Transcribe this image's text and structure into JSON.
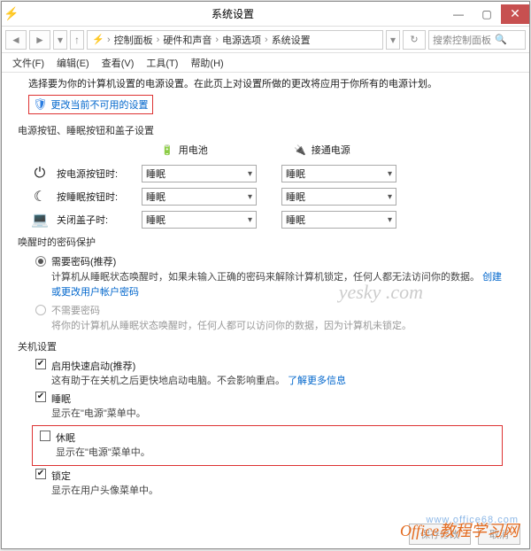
{
  "titlebar": {
    "title": "系统设置"
  },
  "breadcrumb": {
    "root_icon": "🖳",
    "parts": [
      "控制面板",
      "硬件和声音",
      "电源选项",
      "系统设置"
    ]
  },
  "search": {
    "placeholder": "搜索控制面板",
    "icon": "🔍"
  },
  "menubar": {
    "file": "文件(F)",
    "edit": "编辑(E)",
    "view": "查看(V)",
    "tools": "工具(T)",
    "help": "帮助(H)"
  },
  "intro": "选择要为你的计算机设置的电源设置。在此页上对设置所做的更改将应用于你所有的电源计划。",
  "change_unavailable": "更改当前不可用的设置",
  "section_power_title": "电源按钮、睡眠按钮和盖子设置",
  "columns": {
    "battery": "用电池",
    "plugged": "接通电源"
  },
  "rows": {
    "power_btn": {
      "label": "按电源按钮时:",
      "battery": "睡眠",
      "plugged": "睡眠"
    },
    "sleep_btn": {
      "label": "按睡眠按钮时:",
      "battery": "睡眠",
      "plugged": "睡眠"
    },
    "lid": {
      "label": "关闭盖子时:",
      "battery": "睡眠",
      "plugged": "睡眠"
    }
  },
  "section_wake_title": "唤醒时的密码保护",
  "pw_required": {
    "label": "需要密码(推荐)",
    "desc_pre": "计算机从睡眠状态唤醒时，如果未输入正确的密码来解除计算机锁定，任何人都无法访问你的数据。",
    "desc_link": "创建或更改用户帐户密码"
  },
  "pw_not_required": {
    "label": "不需要密码",
    "desc": "将你的计算机从睡眠状态唤醒时，任何人都可以访问你的数据，因为计算机未锁定。"
  },
  "section_shutdown_title": "关机设置",
  "shutdown": {
    "fast": {
      "label": "启用快速启动(推荐)",
      "desc_pre": "这有助于在关机之后更快地启动电脑。不会影响重启。",
      "desc_link": "了解更多信息"
    },
    "sleep": {
      "label": "睡眠",
      "desc": "显示在\"电源\"菜单中。"
    },
    "hib": {
      "label": "休眠",
      "desc": "显示在\"电源\"菜单中。"
    },
    "lock": {
      "label": "锁定",
      "desc": "显示在用户头像菜单中。"
    }
  },
  "footer": {
    "save": "保存修改",
    "cancel": "取消"
  },
  "watermark": {
    "yesky": "yesky .com",
    "site1": "www.office68.com",
    "site2": "Office教程学习网"
  }
}
